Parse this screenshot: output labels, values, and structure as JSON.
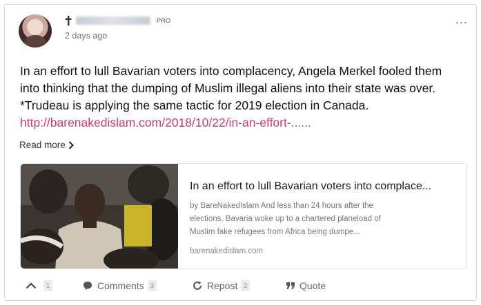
{
  "post": {
    "time": "2 days ago",
    "badge": "PRO",
    "more": "...",
    "text_lines": [
      "In an effort to lull Bavarian voters into complacency, Angela Merkel fooled them",
      "into thinking that the dumping of Muslim illegal aliens into their state was over.",
      "*Trudeau is applying the same tactic for 2019 election in Canada."
    ],
    "link": "http://barenakedislam.com/2018/10/22/in-an-effort-......",
    "read_more": "Read more"
  },
  "preview": {
    "title": "In an effort to lull Bavarian voters into complace...",
    "desc_lines": [
      "by BareNakedIslam And less than 24 hours after the",
      "elections, Bavaria woke up to a chartered planeload of",
      "Muslim fake refugees from Africa being dumpe..."
    ],
    "domain": "barenakedislam.com"
  },
  "footer": {
    "upvote_count": "1",
    "comments_label": "Comments",
    "comments_count": "3",
    "repost_label": "Repost",
    "repost_count": "2",
    "quote_label": "Quote"
  },
  "colors": {
    "link": "#d03a63",
    "muted": "#777777",
    "border": "#d9d9d9"
  },
  "icons": [
    "cross-icon",
    "chevron-right-icon",
    "chevron-up-icon",
    "comment-icon",
    "repost-icon",
    "quote-icon"
  ]
}
